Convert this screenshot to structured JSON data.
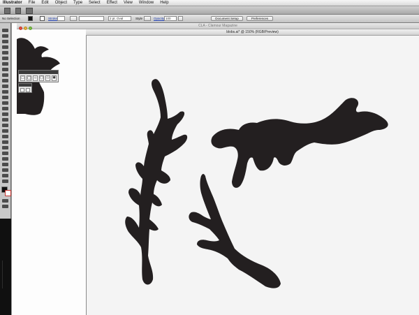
{
  "menubar": {
    "app_name": "Illustrator",
    "items": [
      "File",
      "Edit",
      "Object",
      "Type",
      "Select",
      "Effect",
      "View",
      "Window",
      "Help"
    ]
  },
  "control_bar": {
    "selection_label": "No Selection",
    "stroke_label": "Stroke",
    "stroke_weight": "",
    "brush_value": "",
    "profile_value": "2 pt. Oval",
    "style_label": "Style",
    "opacity_label": "Opacity",
    "opacity_value": "100",
    "document_setup_label": "Document Setup",
    "preferences_label": "Preferences"
  },
  "back_window": {
    "title": "CLA - Clamour Magazine"
  },
  "front_window": {
    "title": "blobs.ai* @ 150% (RGB/Preview)"
  },
  "colors": {
    "blob_fill": "#231f20",
    "canvas": "#f4f4f4",
    "close_button": "#e94b3c",
    "minimize_button": "#e8b23a",
    "zoom_button": "#7cc045"
  },
  "icons": {
    "shapes_panel": [
      "rectangle-icon",
      "rounded-rectangle-icon",
      "ellipse-icon",
      "polygon-icon",
      "star-icon",
      "flare-icon"
    ]
  }
}
